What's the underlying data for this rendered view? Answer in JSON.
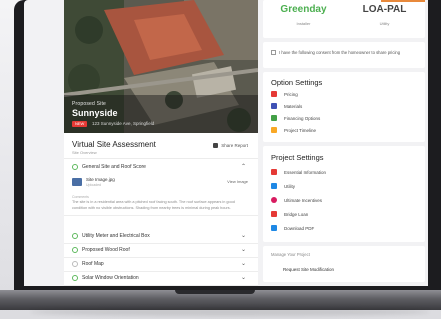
{
  "site": {
    "caption": "Proposed Site",
    "name": "Sunnyside",
    "badge": "NEW",
    "meta": "123 Sunnyside Ave, Springfield"
  },
  "assessment": {
    "title": "Virtual Site Assessment",
    "subtitle": "Site Overview",
    "share_label": "Share Report",
    "sections": [
      {
        "label": "General Site and Roof Score",
        "checked": true,
        "expanded": true
      },
      {
        "label": "Utility Meter and Electrical Box",
        "checked": true,
        "expanded": false
      },
      {
        "label": "Proposed Wood Roof",
        "checked": true,
        "expanded": false
      },
      {
        "label": "Roof Map",
        "checked": false,
        "expanded": false
      },
      {
        "label": "Solar Window Orientation",
        "checked": true,
        "expanded": false
      }
    ],
    "file": {
      "name": "Site Image.jpg",
      "sub": "Uploaded",
      "action": "View Image"
    },
    "note_label": "Comments",
    "note_text": "The site is in a residential area with a pitched roof facing south. The roof surface appears in good condition with no visible obstructions. Shading from nearby trees is minimal during peak hours."
  },
  "kpis": [
    {
      "value": "Greenday",
      "sub": "Installer",
      "color": "#4caf50"
    },
    {
      "value": "LOA-PAL",
      "sub": "Utility",
      "color": "#444444"
    }
  ],
  "consent_text": "I have the following consent from the homeowner to share pricing",
  "option_settings": {
    "title": "Option Settings",
    "items": [
      {
        "label": "Pricing",
        "icon": "dollar-icon",
        "color": "#e53935"
      },
      {
        "label": "Materials",
        "icon": "grid-icon",
        "color": "#3f51b5"
      },
      {
        "label": "Financing Options",
        "icon": "bank-icon",
        "color": "#43a047"
      },
      {
        "label": "Project Timeline",
        "icon": "timeline-icon",
        "color": "#f9a825"
      }
    ]
  },
  "project_settings": {
    "title": "Project Settings",
    "items": [
      {
        "label": "Essential Information",
        "icon": "info-icon",
        "color": "#e53935"
      },
      {
        "label": "Utility",
        "icon": "bolt-icon",
        "color": "#1e88e5"
      },
      {
        "label": "Ultimate Incentives",
        "icon": "tag-icon",
        "color": "#d81b60"
      },
      {
        "label": "Bridge Loan",
        "icon": "bridge-icon",
        "color": "#e53935"
      },
      {
        "label": "Download PDF",
        "icon": "download-icon",
        "color": "#1e88e5"
      }
    ]
  },
  "footer": {
    "sub": "Manage Your Project",
    "main": "Request Site Modification"
  }
}
